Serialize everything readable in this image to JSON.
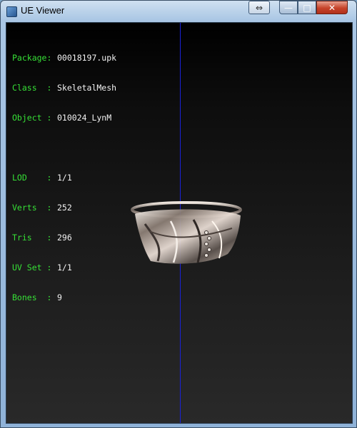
{
  "window": {
    "title": "UE Viewer",
    "buttons": {
      "resize": "⇔",
      "minimize": "—",
      "maximize": "□",
      "close": "✕"
    }
  },
  "info": {
    "package": {
      "label": "Package:",
      "value": "00018197.upk"
    },
    "class": {
      "label": "Class  :",
      "value": "SkeletalMesh"
    },
    "object": {
      "label": "Object :",
      "value": "010024_LynM"
    },
    "lod": {
      "label": "LOD    :",
      "value": "1/1"
    },
    "verts": {
      "label": "Verts  :",
      "value": "252"
    },
    "tris": {
      "label": "Tris   :",
      "value": "296"
    },
    "uvset": {
      "label": "UV Set :",
      "value": "1/1"
    },
    "bones": {
      "label": "Bones  :",
      "value": "9"
    }
  },
  "colors": {
    "label": "#36e036",
    "value": "#f2f2f2",
    "axis": "#1a22d9"
  }
}
